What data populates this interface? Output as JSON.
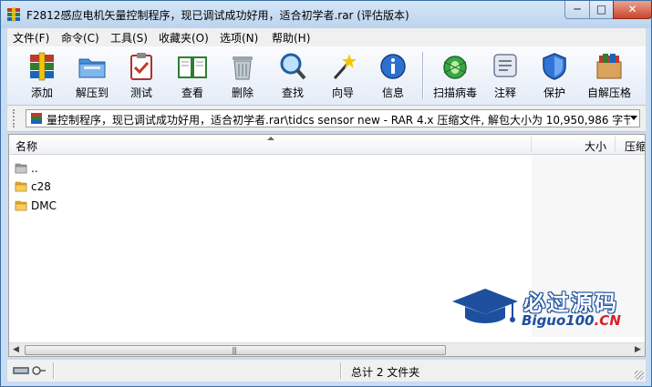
{
  "window": {
    "title": "F2812感应电机矢量控制程序，现已调试成功好用，适合初学者.rar (评估版本)",
    "min_glyph": "─",
    "max_glyph": "□",
    "close_glyph": "✕"
  },
  "menu": [
    "文件(F)",
    "命令(C)",
    "工具(S)",
    "收藏夹(O)",
    "选项(N)",
    "帮助(H)"
  ],
  "toolbar": [
    {
      "label": "添加",
      "icon": "add-archive-icon"
    },
    {
      "label": "解压到",
      "icon": "extract-folder-icon"
    },
    {
      "label": "测试",
      "icon": "test-clipboard-icon"
    },
    {
      "label": "查看",
      "icon": "view-book-icon"
    },
    {
      "label": "删除",
      "icon": "trash-icon"
    },
    {
      "label": "查找",
      "icon": "magnifier-icon"
    },
    {
      "label": "向导",
      "icon": "wizard-wand-icon"
    },
    {
      "label": "信息",
      "icon": "info-icon"
    },
    {
      "label": "扫描病毒",
      "icon": "virus-scan-icon"
    },
    {
      "label": "注释",
      "icon": "comment-icon"
    },
    {
      "label": "保护",
      "icon": "shield-icon"
    },
    {
      "label": "自解压格",
      "icon": "sfx-box-icon"
    }
  ],
  "address": {
    "path": "量控制程序，现已调试成功好用，适合初学者.rar\\tidcs sensor new - RAR 4.x 压缩文件, 解包大小为 10,950,986 字节"
  },
  "columns": {
    "name": "名称",
    "size": "大小",
    "packed": "压缩"
  },
  "files": [
    {
      "name": "..",
      "icon": "parent-folder-icon"
    },
    {
      "name": "c28",
      "icon": "folder-icon"
    },
    {
      "name": "DMC",
      "icon": "folder-icon"
    }
  ],
  "watermark": {
    "title": "必过源码",
    "site_main": "Biguo100",
    "site_suffix": ".CN"
  },
  "status": {
    "summary": "总计 2 文件夹"
  },
  "colors": {
    "accent": "#1d4f9e",
    "close": "#c9462c",
    "watermark_red": "#d8202a"
  }
}
